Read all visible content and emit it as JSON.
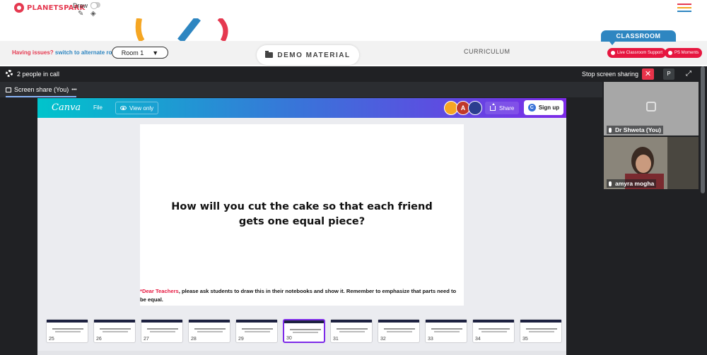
{
  "brand": {
    "name": "PLANETSPARK",
    "accent": "#e53950"
  },
  "toolbar": {
    "draw_label": "Draw"
  },
  "header": {
    "issue_text": "Having issues?",
    "issue_link": "switch to alternate room",
    "room_label": "Room 1",
    "room_arrow": "▼",
    "demo_label": "DEMO MATERIAL",
    "curriculum_label": "CURRICULUM",
    "classroom_tab": "CLASSROOM",
    "live_support": "Live Classroom Support",
    "ps_moments": "PS Moments"
  },
  "meet": {
    "people_count": "2 people in call",
    "stop_sharing": "Stop screen sharing",
    "close_glyph": "✕",
    "p_button": "P",
    "share_tab": "Screen share (You)",
    "share_more": "•••"
  },
  "canva": {
    "logo": "Canva",
    "file": "File",
    "view_only": "View only",
    "avatars": [
      {
        "letter": "",
        "color": "#f5a623"
      },
      {
        "letter": "A",
        "color": "#c0392b"
      },
      {
        "letter": "",
        "color": "#2c3e90"
      }
    ],
    "share": "Share",
    "sign_up": "Sign up",
    "sign_up_icon": "C"
  },
  "slide": {
    "title": "How will you cut the cake so that each friend gets one equal piece?",
    "note_star": "*",
    "note_highlight": "Dear Teachers",
    "note_rest": ", please ask students to draw this in their notebooks and show it. Remember to emphasize that parts need to be equal."
  },
  "thumbnails": [
    {
      "num": "25",
      "active": false
    },
    {
      "num": "26",
      "active": false
    },
    {
      "num": "27",
      "active": false
    },
    {
      "num": "28",
      "active": false
    },
    {
      "num": "29",
      "active": false
    },
    {
      "num": "30",
      "active": true
    },
    {
      "num": "31",
      "active": false
    },
    {
      "num": "32",
      "active": false
    },
    {
      "num": "33",
      "active": false
    },
    {
      "num": "34",
      "active": false
    },
    {
      "num": "35",
      "active": false
    }
  ],
  "participants": [
    {
      "name": "Dr Shweta (You)"
    },
    {
      "name": "amyra mogha"
    }
  ]
}
